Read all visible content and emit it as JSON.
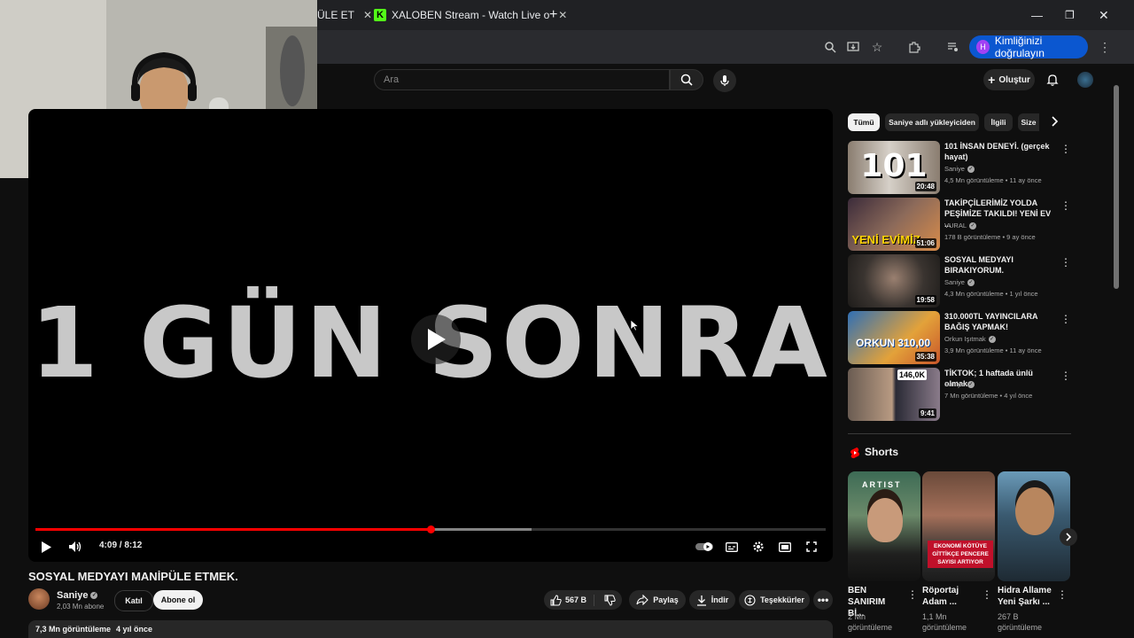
{
  "browser": {
    "tabs": [
      {
        "label": "ÜLE ET"
      },
      {
        "label": "XALOBEN Stream - Watch Live o"
      }
    ],
    "profile_button": "Kimliğinizi doğrulayın",
    "profile_initial": "H"
  },
  "header": {
    "search_placeholder": "Ara",
    "create_label": "Oluştur"
  },
  "player": {
    "overlay_text": "1 GÜN SONRA",
    "time": "4:09 / 8:12",
    "progress_fraction": 0.5,
    "buffered_fraction": 0.628,
    "accent": "#ff0000"
  },
  "video": {
    "title": "SOSYAL MEDYAYI MANİPÜLE ETMEK.",
    "channel": "Saniye",
    "subscribers": "2,03 Mn abone",
    "join_label": "Katıl",
    "subscribe_label": "Abone ol",
    "likes": "567 B",
    "share_label": "Paylaş",
    "download_label": "İndir",
    "thanks_label": "Teşekkürler",
    "views": "7,3 Mn görüntüleme",
    "age": "4 yıl önce"
  },
  "chips": [
    "Tümü",
    "Saniye adlı yükleyiciden",
    "İlgili",
    "Size"
  ],
  "recommendations": [
    {
      "title": "101 İNSAN DENEYİ. (gerçek hayat)",
      "channel": "Saniye",
      "meta": "4,5 Mn görüntüleme • 11 ay önce",
      "duration": "20:48",
      "thumb_text": "101"
    },
    {
      "title": "TAKİPÇİLERİMİZ YOLDA PEŞİMİZE TAKILDI! YENİ EV ...",
      "channel": "VURAL",
      "meta": "178 B görüntüleme • 9 ay önce",
      "duration": "51:06",
      "thumb_text": "YENİ EVİMİZ"
    },
    {
      "title": "SOSYAL MEDYAYI BIRAKIYORUM.",
      "channel": "Saniye",
      "meta": "4,3 Mn görüntüleme • 1 yıl önce",
      "duration": "19:58",
      "thumb_text": ""
    },
    {
      "title": "310.000TL YAYINCILARA BAĞIŞ YAPMAK!",
      "channel": "Orkun Işıtmak",
      "meta": "3,9 Mn görüntüleme • 11 ay önce",
      "duration": "35:38",
      "thumb_text": "ORKUN 310,00"
    },
    {
      "title": "TİKTOK; 1 haftada ünlü olmak.",
      "channel": "Saniye",
      "meta": "7 Mn görüntüleme • 4 yıl önce",
      "duration": "9:41",
      "thumb_text": "146,0K"
    }
  ],
  "shorts": {
    "heading": "Shorts",
    "items": [
      {
        "title": "BEN SANIRIM Bİ...",
        "views": "2 Mn görüntüleme",
        "badge": "ARTIST"
      },
      {
        "title": "Röportaj Adam ...",
        "views": "1,1 Mn görüntüleme",
        "badge": "EKONOMİ KÖTÜYE GİTTİKÇE PENCERE SAYISI ARTIYOR"
      },
      {
        "title": "Hidra Allame Yeni Şarkı ...",
        "views": "267 B görüntüleme",
        "badge": ""
      }
    ]
  }
}
